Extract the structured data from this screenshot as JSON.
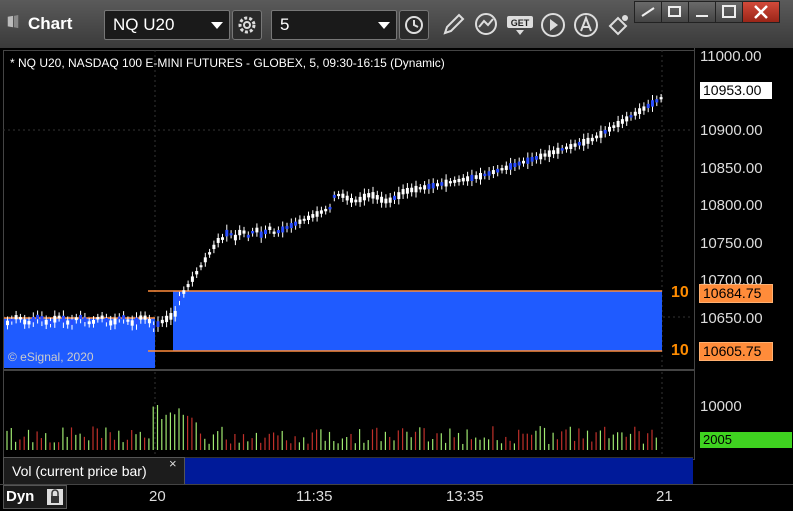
{
  "titlebar": {
    "app_title": "Chart",
    "symbol": "NQ U20",
    "interval": "5"
  },
  "chart": {
    "description_line": "* NQ U20, NASDAQ 100 E-MINI FUTURES - GLOBEX, 5, 09:30-16:15 (Dynamic)",
    "copyright": "© eSignal, 2020",
    "price_ticks": [
      "11000.00",
      "10900.00",
      "10850.00",
      "10800.00",
      "10750.00",
      "10700.00",
      "10650.00"
    ],
    "last_price_label": "10953.00",
    "box_top_label": "10684.75",
    "box_bottom_label": "10605.75",
    "box_top_prefix": "10",
    "box_bottom_prefix": "10",
    "box_color": "#1f5bff",
    "line_color": "#ff8c3a"
  },
  "volume": {
    "axis_tick": "10000",
    "current_label": "2005",
    "current_color": "#3fd320",
    "study_label": "Vol (current price bar)",
    "close_glyph": "×"
  },
  "time_axis": {
    "mode_label": "Dyn",
    "ticks": [
      "20",
      "11:35",
      "13:35",
      "21"
    ]
  }
}
